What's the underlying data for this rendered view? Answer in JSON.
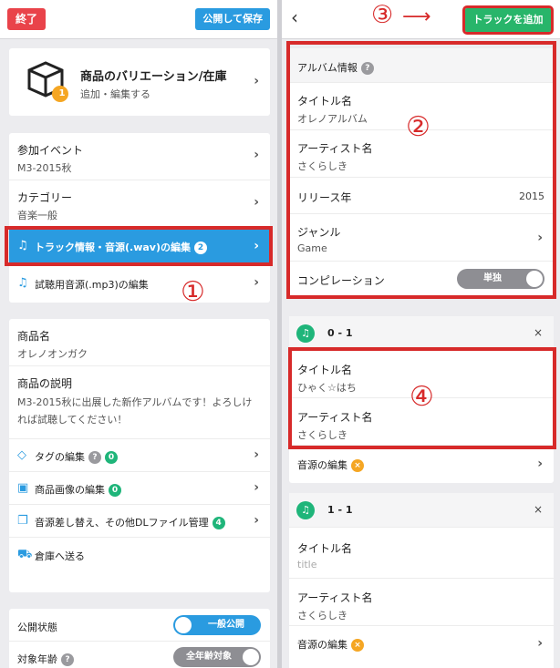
{
  "left": {
    "topbar": {
      "quit_label": "終了",
      "publish_save_label": "公開して保存"
    },
    "variation": {
      "title": "商品のバリエーション/在庫",
      "subtitle": "追加・編集する",
      "badge": "1"
    },
    "event": {
      "label": "参加イベント",
      "value": "M3-2015秋"
    },
    "category": {
      "label": "カテゴリー",
      "value": "音楽一般"
    },
    "track_edit": {
      "label": "トラック情報・音源(.wav)の編集",
      "badge": "2"
    },
    "trial_edit": {
      "label": "試聴用音源(.mp3)の編集"
    },
    "product": {
      "name_label": "商品名",
      "name_value": "オレノオンガク",
      "desc_label": "商品の説明",
      "desc_line1": "M3-2015秋に出展した新作アルバムです！よろしけ",
      "desc_line2": "れば試聴してください！"
    },
    "tags": {
      "label": "タグの編集",
      "help": "?",
      "badge": "0"
    },
    "images": {
      "label": "商品画像の編集",
      "badge": "0"
    },
    "files": {
      "label": "音源差し替え、その他DLファイル管理",
      "badge": "4"
    },
    "warehouse": {
      "label": "倉庫へ送る"
    },
    "publish_state": {
      "label": "公開状態",
      "toggle": "一般公開"
    },
    "age": {
      "label": "対象年齢",
      "help": "?",
      "toggle": "全年齢対象"
    },
    "annotation": "①"
  },
  "right": {
    "topbar": {
      "back": "‹",
      "add_track_label": "トラックを追加",
      "annotation": "③",
      "arrow": "⟶"
    },
    "album": {
      "header": "アルバム情報",
      "help": "?",
      "title_label": "タイトル名",
      "title_value": "オレノアルバム",
      "artist_label": "アーティスト名",
      "artist_value": "さくらしき",
      "year_label": "リリース年",
      "year_value": "2015",
      "genre_label": "ジャンル",
      "genre_value": "Game",
      "compilation_label": "コンピレーション",
      "compilation_toggle": "単独",
      "annotation": "②"
    },
    "tracks": [
      {
        "number": "0 - 1",
        "close": "×",
        "title_label": "タイトル名",
        "title_value": "ひゃく☆はち",
        "artist_label": "アーティスト名",
        "artist_value": "さくらしき",
        "source_label": "音源の編集",
        "source_badge": "×",
        "annotation": "④"
      },
      {
        "number": "1 - 1",
        "close": "×",
        "title_label": "タイトル名",
        "title_placeholder": "title",
        "artist_label": "アーティスト名",
        "artist_value": "さくらしき",
        "source_label": "音源の編集",
        "source_badge": "×"
      }
    ]
  },
  "colors": {
    "red": "#e9434a",
    "blue": "#2a9be0",
    "green": "#28b56a",
    "annotation": "#d72a2a",
    "orange": "#f5a623"
  }
}
